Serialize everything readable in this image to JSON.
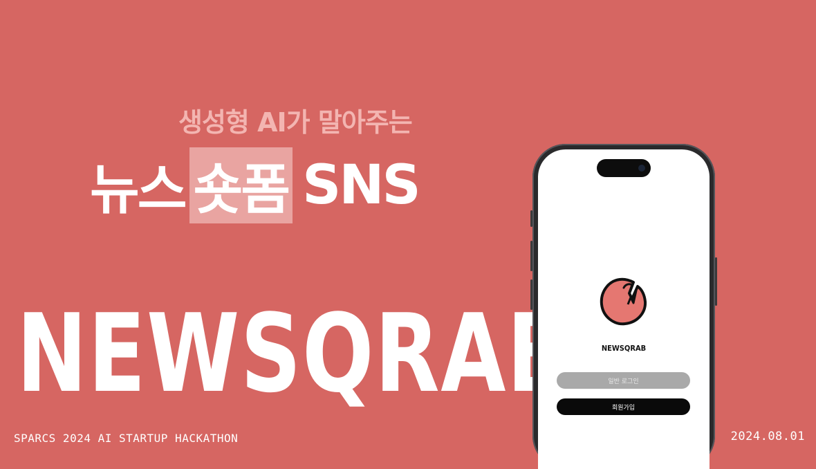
{
  "subtitle": "생성형 AI가 말아주는",
  "headline": {
    "part1": "뉴스",
    "highlight": "숏폼",
    "part2": "SNS"
  },
  "brand_title": "NEWSQRAB",
  "footer": {
    "event": "SPARCS 2024 AI STARTUP HACKATHON",
    "date": "2024.08.01"
  },
  "phone": {
    "app_name": "NEWSQRAB",
    "login_button": "일반 로그인",
    "signup_button": "회원가입",
    "logo_icon": "crab-claw-icon"
  },
  "colors": {
    "background": "#d66662",
    "highlight": "#e9a4a1",
    "logo_fill": "#e57771"
  }
}
